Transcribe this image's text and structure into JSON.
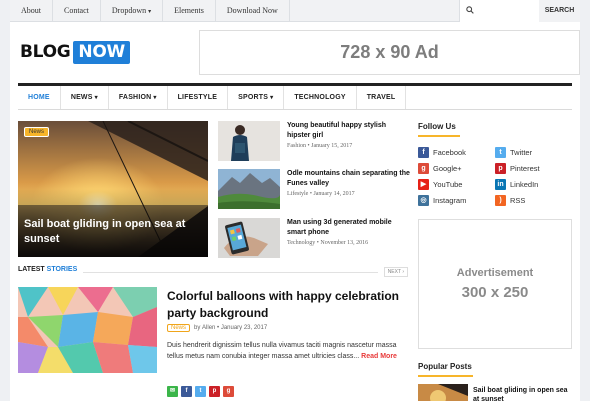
{
  "topbar": {
    "links": [
      "About",
      "Contact",
      "Dropdown",
      "Elements",
      "Download Now"
    ],
    "search_placeholder": "",
    "search_button": "SEARCH"
  },
  "header": {
    "logo_part1": "BLOG",
    "logo_part2": "NOW",
    "ad_label": "728 x 90 Ad"
  },
  "mainnav": {
    "items": [
      "HOME",
      "NEWS",
      "FASHION",
      "LIFESTYLE",
      "SPORTS",
      "TECHNOLOGY",
      "TRAVEL"
    ]
  },
  "featured": {
    "tag": "News",
    "title": "Sail boat gliding in open sea at sunset"
  },
  "side_posts": [
    {
      "title": "Young beautiful happy stylish hipster girl",
      "category": "Fashion",
      "date": "January 15, 2017"
    },
    {
      "title": "Odle mountains chain separating the Funes valley",
      "category": "Lifestyle",
      "date": "January 14, 2017"
    },
    {
      "title": "Man using 3d generated mobile smart phone",
      "category": "Technology",
      "date": "November 13, 2016"
    }
  ],
  "latest": {
    "heading_part1": "LATEST",
    "heading_part2": "STORIES",
    "next_label": "NEXT",
    "post": {
      "title": "Colorful balloons with happy celebration party background",
      "badge": "News",
      "author_prefix": "by",
      "author": "Allen",
      "date": "January 23, 2017",
      "excerpt": "Duis hendrerit dignissim tellus nulla vivamus taciti magnis nascetur massa tellus metus nam conubia integer massa amet ultricies class...",
      "read_more": "Read More"
    },
    "share_icons": [
      "email-share-icon",
      "facebook-share-icon",
      "twitter-share-icon",
      "pinterest-share-icon",
      "google-plus-share-icon"
    ]
  },
  "sidebar": {
    "follow_heading": "Follow Us",
    "social": [
      {
        "label": "Facebook",
        "icon": "facebook-icon",
        "color": "#3b5998"
      },
      {
        "label": "Twitter",
        "icon": "twitter-icon",
        "color": "#55acee"
      },
      {
        "label": "Google+",
        "icon": "google-plus-icon",
        "color": "#dd4b39"
      },
      {
        "label": "Pinterest",
        "icon": "pinterest-icon",
        "color": "#cb2027"
      },
      {
        "label": "YouTube",
        "icon": "youtube-icon",
        "color": "#e62117"
      },
      {
        "label": "LinkedIn",
        "icon": "linkedin-icon",
        "color": "#0976b4"
      },
      {
        "label": "Instagram",
        "icon": "instagram-icon",
        "color": "#3f729b"
      },
      {
        "label": "RSS",
        "icon": "rss-icon",
        "color": "#f26522"
      }
    ],
    "ad_line1": "Advertisement",
    "ad_line2": "300 x 250",
    "popular_heading": "Popular Posts",
    "popular_first_title": "Sail boat gliding in open sea at sunset"
  },
  "colors": {
    "accent": "#1f7fd8",
    "highlight": "#f7b52a",
    "read_more": "#e83a3a"
  }
}
